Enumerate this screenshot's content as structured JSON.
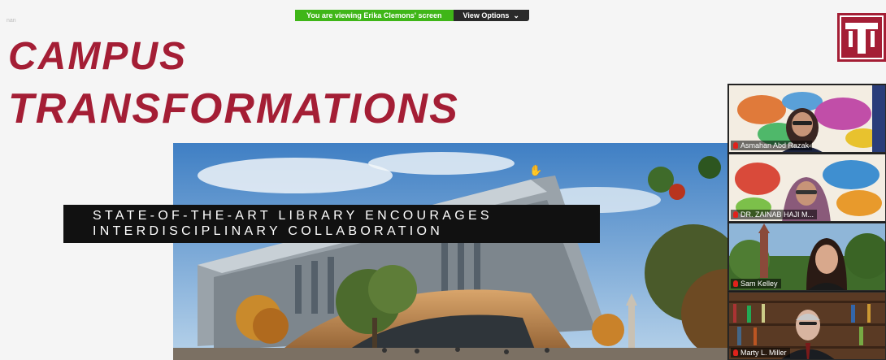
{
  "share_banner": {
    "message": "You are viewing Erika Clemons' screen",
    "options_label": "View Options",
    "options_icon": "chevron-down-icon"
  },
  "slide": {
    "corner_label": "nan",
    "title_line1": "CAMPUS",
    "title_line2": "TRANSFORMATIONS",
    "caption_line1": "STATE-OF-THE-ART LIBRARY ENCOURAGES",
    "caption_line2": "INTERDISCIPLINARY COLLABORATION",
    "accent_color": "#a41e35",
    "logo_icon": "temple-t-logo"
  },
  "participants": [
    {
      "name": "Asmahan Abd Razak",
      "muted": true,
      "background": "world-map"
    },
    {
      "name": "DR. ZAINAB HAJI M...",
      "muted": true,
      "background": "world-map"
    },
    {
      "name": "Sam Kelley",
      "muted": true,
      "background": "campus-bell-tower"
    },
    {
      "name": "Marty L. Miller",
      "muted": true,
      "background": "bookshelves"
    }
  ]
}
